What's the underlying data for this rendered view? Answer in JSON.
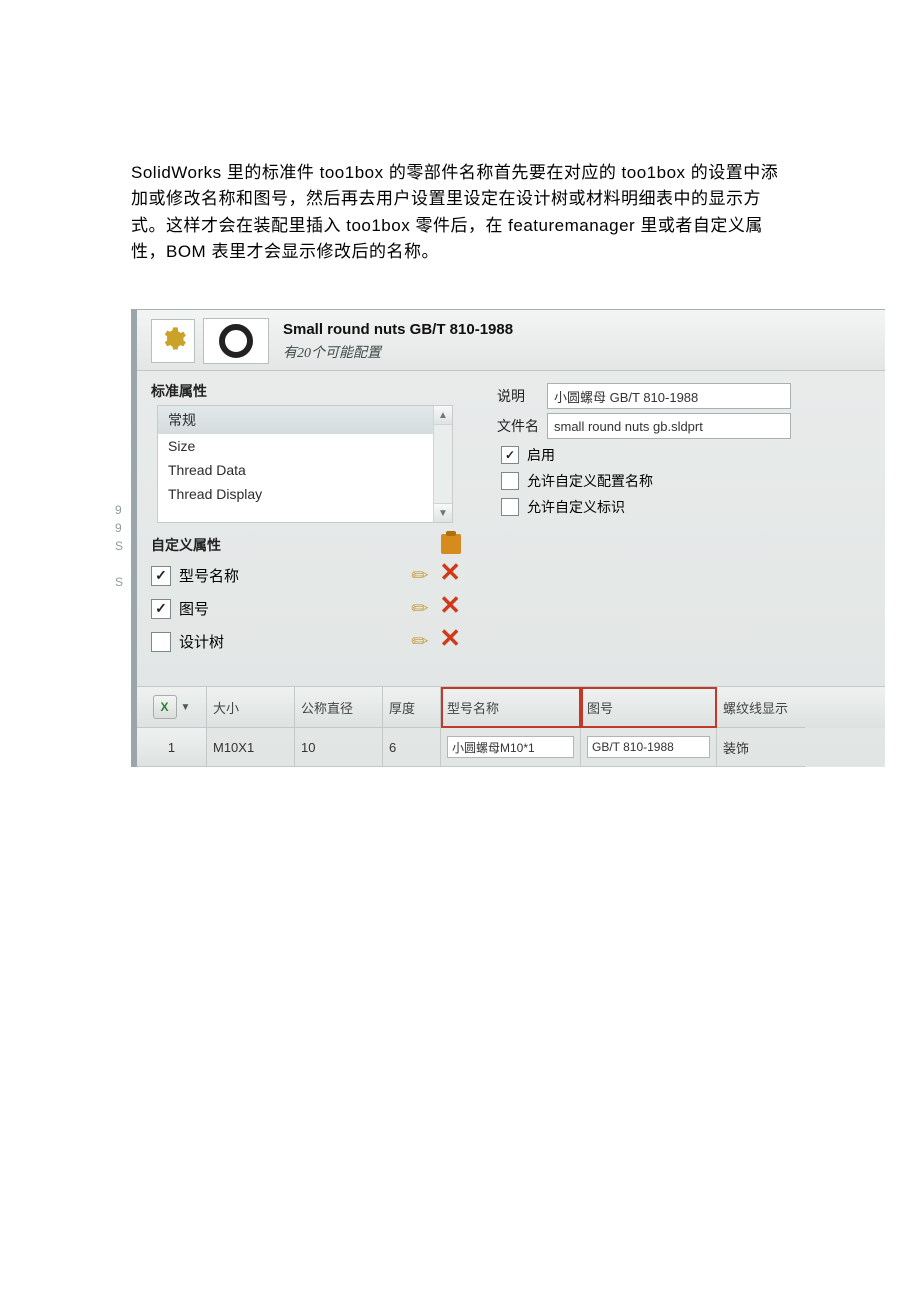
{
  "body_text": "SolidWorks 里的标准件 too1box 的零部件名称首先要在对应的 too1box 的设置中添加或修改名称和图号，然后再去用户设置里设定在设计树或材料明细表中的显示方式。这样才会在装配里插入 too1box 零件后，在 featuremanager 里或者自定义属性，BOM 表里才会显示修改后的名称。",
  "header": {
    "title": "Small round nuts GB/T 810-1988",
    "subtitle": "有20个可能配置"
  },
  "standard_attrs": {
    "label": "标准属性",
    "items": [
      "常规",
      "Size",
      "Thread Data",
      "Thread Display"
    ]
  },
  "custom_attrs": {
    "label": "自定义属性",
    "rows": [
      {
        "checked": true,
        "label": "型号名称"
      },
      {
        "checked": true,
        "label": "图号"
      },
      {
        "checked": false,
        "label": "设计树"
      }
    ]
  },
  "right": {
    "desc_label": "说明",
    "desc_value": "小圆螺母 GB/T 810-1988",
    "file_label": "文件名",
    "file_value": "small round nuts gb.sldprt",
    "enable_label": "启用",
    "allow_cfg_name": "允许自定义配置名称",
    "allow_flag": "允许自定义标识"
  },
  "side_numbers": "9\n9\nS\n\nS",
  "table": {
    "headers": [
      "大小",
      "公称直径",
      "厚度",
      "型号名称",
      "图号",
      "螺纹线显示"
    ],
    "row": {
      "num": "1",
      "size": "M10X1",
      "dia": "10",
      "thick": "6",
      "model": "小圆螺母M10*1",
      "draw": "GB/T 810-1988",
      "thread": "装饰"
    }
  }
}
